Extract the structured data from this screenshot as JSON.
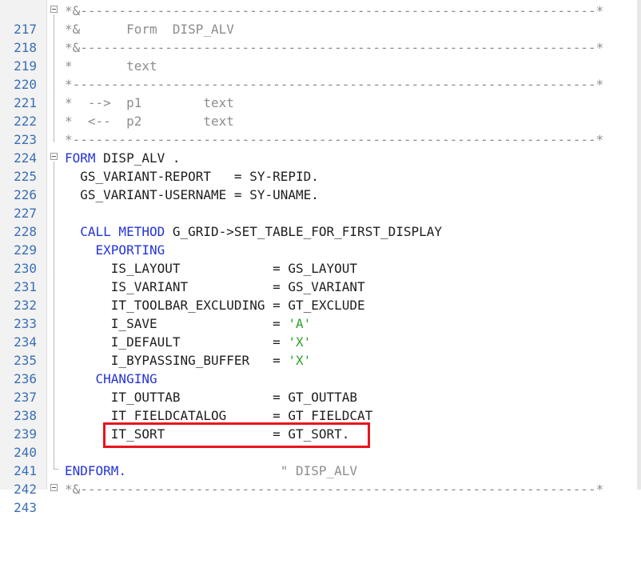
{
  "lines": [
    {
      "no": "217",
      "text": "*&-------------------------------------------------------------------*"
    },
    {
      "no": "218",
      "text": "*&      Form  DISP_ALV"
    },
    {
      "no": "219",
      "text": "*&-------------------------------------------------------------------*"
    },
    {
      "no": "220",
      "text": "*       text"
    },
    {
      "no": "221",
      "text": "*--------------------------------------------------------------------*"
    },
    {
      "no": "222",
      "text": "*  -->  p1        text"
    },
    {
      "no": "223",
      "text": "*  <--  p2        text"
    },
    {
      "no": "224",
      "text": "*--------------------------------------------------------------------*"
    },
    {
      "no": "225",
      "kw": "FORM",
      "rest": " DISP_ALV ."
    },
    {
      "no": "226",
      "text": "  GS_VARIANT-REPORT   = SY-REPID."
    },
    {
      "no": "227",
      "text": "  GS_VARIANT-USERNAME = SY-UNAME."
    },
    {
      "no": "228",
      "text": ""
    },
    {
      "no": "229",
      "kw": "  CALL METHOD",
      "rest": " G_GRID->SET_TABLE_FOR_FIRST_DISPLAY"
    },
    {
      "no": "230",
      "kw": "    EXPORTING",
      "rest": ""
    },
    {
      "no": "231",
      "text": "      IS_LAYOUT            = GS_LAYOUT"
    },
    {
      "no": "232",
      "text": "      IS_VARIANT           = GS_VARIANT"
    },
    {
      "no": "233",
      "text": "      IT_TOOLBAR_EXCLUDING = GT_EXCLUDE"
    },
    {
      "no": "234",
      "pre": "      I_SAVE               = ",
      "str": "'A'"
    },
    {
      "no": "235",
      "pre": "      I_DEFAULT            = ",
      "str": "'X'"
    },
    {
      "no": "236",
      "pre": "      I_BYPASSING_BUFFER   = ",
      "str": "'X'"
    },
    {
      "no": "237",
      "kw": "    CHANGING",
      "rest": ""
    },
    {
      "no": "238",
      "text": "      IT_OUTTAB            = GT_OUTTAB"
    },
    {
      "no": "239",
      "text": "      IT_FIELDCATALOG      = GT_FIELDCAT"
    },
    {
      "no": "240",
      "text": "      IT_SORT              = GT_SORT."
    },
    {
      "no": "241",
      "text": ""
    },
    {
      "no": "242",
      "kw": "ENDFORM",
      "rest": ".",
      "cm": "                    \" DISP_ALV"
    },
    {
      "no": "243",
      "text": "*&-------------------------------------------------------------------*"
    }
  ]
}
